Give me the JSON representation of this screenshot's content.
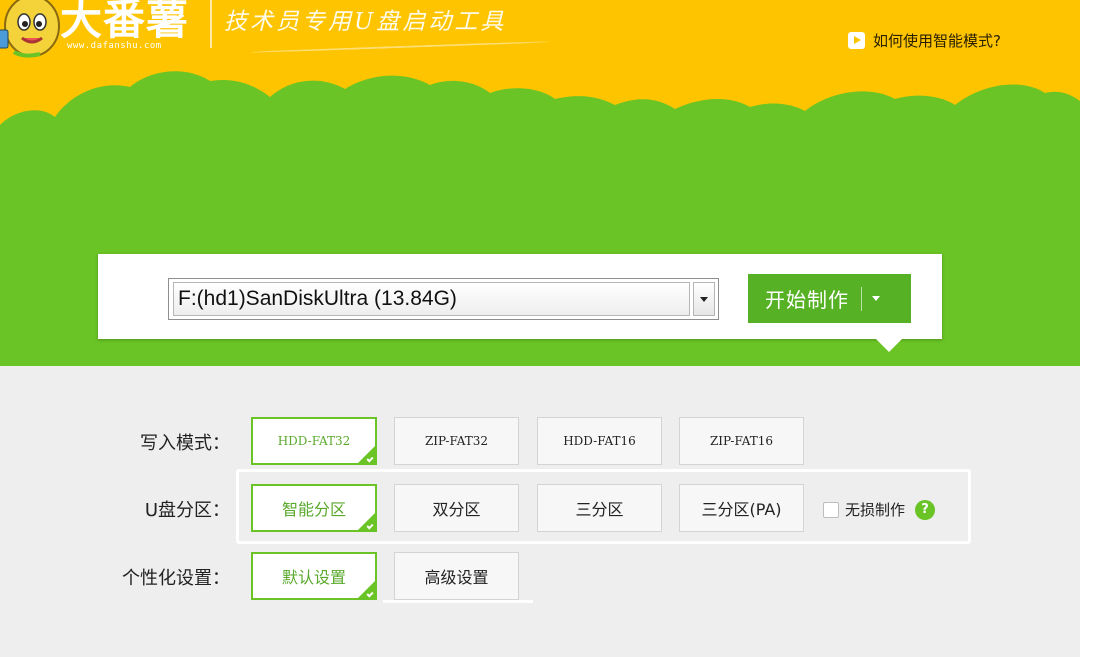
{
  "header": {
    "logo_title": "大番薯",
    "logo_url": "www.dafanshu.com",
    "slogan": "技术员专用U盘启动工具",
    "help_link": "如何使用智能模式?"
  },
  "drive": {
    "selected": "F:(hd1)SanDiskUltra (13.84G)"
  },
  "start_button": {
    "label": "开始制作"
  },
  "write_mode": {
    "label": "写入模式：",
    "options": [
      "HDD-FAT32",
      "ZIP-FAT32",
      "HDD-FAT16",
      "ZIP-FAT16"
    ],
    "selected": "HDD-FAT32"
  },
  "partition": {
    "label": "U盘分区：",
    "options": [
      "智能分区",
      "双分区",
      "三分区",
      "三分区(PA)"
    ],
    "selected": "智能分区",
    "lossless_label": "无损制作",
    "lossless_checked": false,
    "help_glyph": "?"
  },
  "personalize": {
    "label": "个性化设置：",
    "options": [
      "默认设置",
      "高级设置"
    ],
    "selected": "默认设置"
  },
  "colors": {
    "header_yellow": "#ffc400",
    "band_green": "#6ac425",
    "button_green": "#56b124",
    "panel_gray": "#eeeeee"
  },
  "icons": [
    "mascot-icon",
    "play-icon",
    "chevron-down-icon",
    "help-circle-icon",
    "check-corner-icon"
  ]
}
